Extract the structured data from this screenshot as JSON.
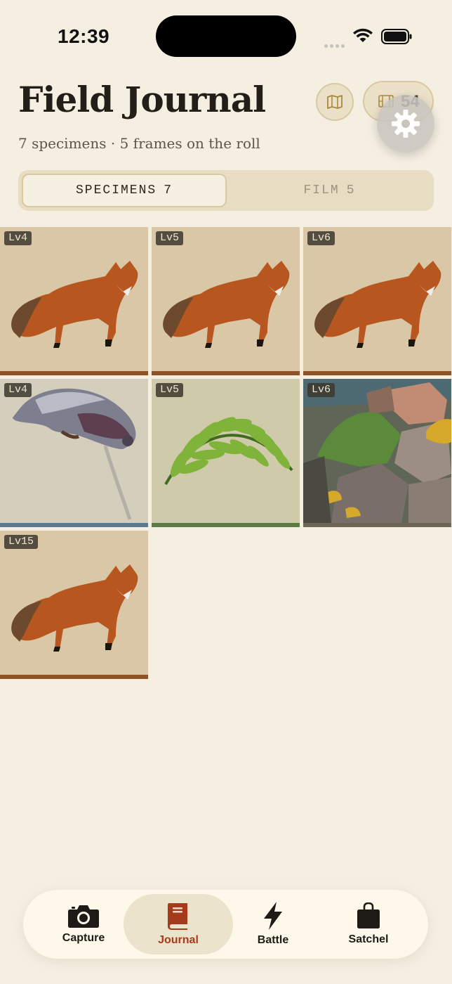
{
  "status_bar": {
    "time": "12:39"
  },
  "header": {
    "title": "Field Journal",
    "subtitle": "7 specimens · 5 frames on the roll",
    "film_count": "54",
    "map_icon": "map-icon",
    "film_icon": "film-icon",
    "settings_icon": "gear-icon"
  },
  "segments": [
    {
      "label": "SPECIMENS",
      "count": "7",
      "selected": true
    },
    {
      "label": "FILM",
      "count": "5",
      "selected": false
    }
  ],
  "specimens": [
    {
      "level": "Lv4",
      "subject": "fox",
      "strip_color": "#8b5228"
    },
    {
      "level": "Lv5",
      "subject": "fox",
      "strip_color": "#8b5228"
    },
    {
      "level": "Lv6",
      "subject": "fox",
      "strip_color": "#8b5228"
    },
    {
      "level": "Lv4",
      "subject": "pigeon",
      "strip_color": "#5d7a8c"
    },
    {
      "level": "Lv5",
      "subject": "fern",
      "strip_color": "#5d7a44"
    },
    {
      "level": "Lv6",
      "subject": "rocks",
      "strip_color": "#6b6656"
    },
    {
      "level": "Lv15",
      "subject": "fox",
      "strip_color": "#8b5228"
    }
  ],
  "tabs": [
    {
      "label": "Capture",
      "icon": "camera-icon",
      "selected": false
    },
    {
      "label": "Journal",
      "icon": "book-icon",
      "selected": true
    },
    {
      "label": "Battle",
      "icon": "lightning-icon",
      "selected": false
    },
    {
      "label": "Satchel",
      "icon": "bag-icon",
      "selected": false
    }
  ],
  "colors": {
    "accent": "#a63a1c",
    "background": "#f5efe2",
    "tile_fox": "#d9c7a6",
    "tile_pigeon": "#d4cfbd",
    "tile_fern": "#cfcaaa"
  }
}
